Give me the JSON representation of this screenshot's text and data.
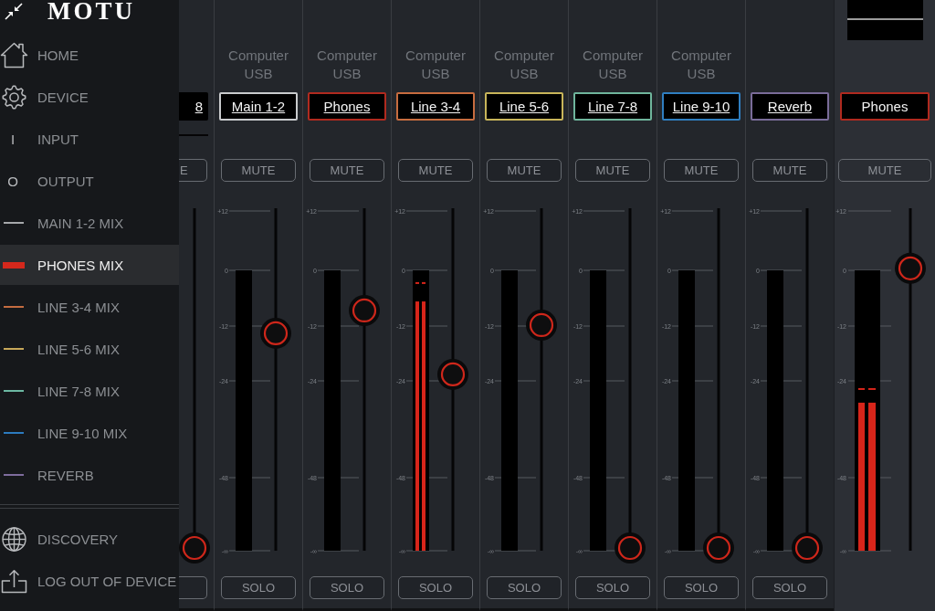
{
  "sidebar": {
    "logo": "MOTU",
    "items": [
      {
        "kind": "house",
        "label": "HOME",
        "selected": false
      },
      {
        "kind": "gear",
        "label": "DEVICE",
        "selected": false
      },
      {
        "kind": "glyph",
        "glyph": "I",
        "label": "INPUT",
        "selected": false
      },
      {
        "kind": "glyph",
        "glyph": "O",
        "label": "OUTPUT",
        "selected": false
      },
      {
        "kind": "mix",
        "label": "MAIN 1-2 MIX",
        "color": "#a6a8ab",
        "selected": false
      },
      {
        "kind": "mix",
        "label": "PHONES MIX",
        "color": "#d4281c",
        "selected": true
      },
      {
        "kind": "mix",
        "label": "LINE 3-4 MIX",
        "color": "#c46c40",
        "selected": false
      },
      {
        "kind": "mix",
        "label": "LINE 5-6 MIX",
        "color": "#c8a85a",
        "selected": false
      },
      {
        "kind": "mix",
        "label": "LINE 7-8 MIX",
        "color": "#6cb8a2",
        "selected": false
      },
      {
        "kind": "mix",
        "label": "LINE 9-10 MIX",
        "color": "#2c7bbf",
        "selected": false
      },
      {
        "kind": "mix",
        "label": "REVERB",
        "color": "#7e6c9d",
        "selected": false
      }
    ],
    "footer_items": [
      {
        "kind": "globe",
        "label": "DISCOVERY",
        "selected": false
      },
      {
        "kind": "upload",
        "label": "LOG OUT OF DEVICE",
        "selected": false
      }
    ]
  },
  "mixer": {
    "strips": [
      {
        "kind": "partial",
        "label": "8",
        "mute_button": "E",
        "fader": {
          "level": 0
        }
      },
      {
        "kind": "channel",
        "source": "Computer USB",
        "label": "Main 1-2",
        "color": "#c9cbcd",
        "mute_button": "MUTE",
        "scale": [
          "+12",
          "0",
          "-12",
          "-24",
          "-48",
          "-∞"
        ],
        "fader": {
          "level": 0.632
        },
        "solo_button": "SOLO"
      },
      {
        "kind": "channel",
        "source": "Computer USB",
        "label": "Phones",
        "color": "#b02a1f",
        "mute_button": "MUTE",
        "scale": [
          "+12",
          "0",
          "-12",
          "-24",
          "-48",
          "-∞"
        ],
        "fader": {
          "level": 0.699
        },
        "solo_button": "SOLO"
      },
      {
        "kind": "channel",
        "source": "Computer USB",
        "label": "Line 3-4",
        "color": "#c76c3f",
        "mute_button": "MUTE",
        "scale": [
          "+12",
          "0",
          "-12",
          "-24",
          "-48",
          "-∞"
        ],
        "meter": {
          "level": 0.889,
          "peak": {
            "level": 0.958
          }
        },
        "fader": {
          "level": 0.511
        },
        "solo_button": "SOLO"
      },
      {
        "kind": "channel",
        "source": "Computer USB",
        "label": "Line 5-6",
        "color": "#c8b55a",
        "mute_button": "MUTE",
        "scale": [
          "+12",
          "0",
          "-12",
          "-24",
          "-48",
          "-∞"
        ],
        "fader": {
          "level": 0.656
        },
        "solo_button": "SOLO"
      },
      {
        "kind": "channel",
        "source": "Computer USB",
        "label": "Line 7-8",
        "color": "#6fb59c",
        "mute_button": "MUTE",
        "scale": [
          "+12",
          "0",
          "-12",
          "-24",
          "-48",
          "-∞"
        ],
        "fader": {
          "level": 0
        },
        "solo_button": "SOLO"
      },
      {
        "kind": "channel",
        "source": "Computer USB",
        "label": "Line 9-10",
        "color": "#2f7ec0",
        "mute_button": "MUTE",
        "scale": [
          "+12",
          "0",
          "-12",
          "-24",
          "-48",
          "-∞"
        ],
        "fader": {
          "level": 0
        },
        "solo_button": "SOLO"
      },
      {
        "kind": "channel",
        "label": "Reverb",
        "color": "#7a6c99",
        "mute_button": "MUTE",
        "scale": [
          "+12",
          "0",
          "-12",
          "-24",
          "-48",
          "-∞"
        ],
        "fader": {
          "level": 0
        },
        "solo_button": "SOLO"
      }
    ],
    "master": {
      "label": "Phones",
      "color": "#b02a1f",
      "mute_button": "MUTE",
      "scale": [
        "+12",
        "0",
        "-12",
        "-24",
        "-48",
        "-∞"
      ],
      "meter": {
        "level": 0.528,
        "peak": {
          "level": 0.58
        }
      },
      "fader": {
        "level": 0.823
      }
    }
  }
}
